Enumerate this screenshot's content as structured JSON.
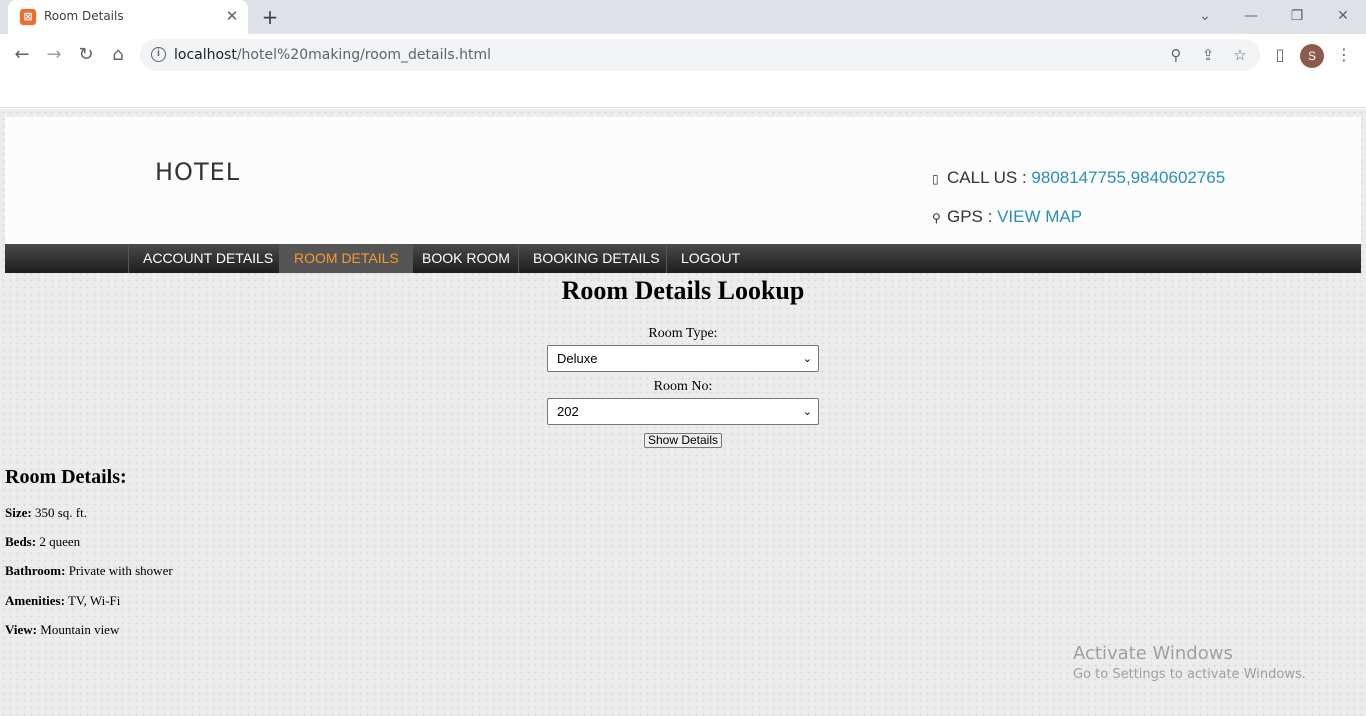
{
  "browser": {
    "tab_title": "Room Details",
    "tab_close": "✕",
    "new_tab": "+",
    "url_host": "localhost",
    "url_path": "/hotel%20making/room_details.html",
    "profile_initial": "S",
    "icons": [
      "hotel-favicon",
      "back-icon",
      "forward-icon",
      "reload-icon",
      "home-icon",
      "info-icon",
      "zoom-icon",
      "share-icon",
      "star-icon",
      "sidebar-icon",
      "menu-icon"
    ]
  },
  "header": {
    "logo": "HOTEL",
    "call_label": "CALL US : ",
    "call_value": "9808147755,9840602765",
    "gps_label": "GPS : ",
    "gps_value": "VIEW MAP",
    "accent_color": "#2a8fb8"
  },
  "nav": {
    "items": [
      "ACCOUNT DETAILS",
      "ROOM DETAILS",
      "BOOK ROOM",
      "BOOKING DETAILS",
      "LOGOUT"
    ],
    "active": "ROOM DETAILS",
    "active_color": "#f59a2f"
  },
  "lookup": {
    "title": "Room Details Lookup",
    "room_type_label": "Room Type:",
    "room_type_value": "Deluxe",
    "room_no_label": "Room No:",
    "room_no_value": "202",
    "button": "Show Details"
  },
  "details": {
    "heading": "Room Details:",
    "rows": [
      {
        "label": "Size:",
        "value": "350 sq. ft."
      },
      {
        "label": "Beds:",
        "value": "2 queen"
      },
      {
        "label": "Bathroom:",
        "value": "Private with shower"
      },
      {
        "label": "Amenities:",
        "value": "TV, Wi-Fi"
      },
      {
        "label": "View:",
        "value": "Mountain view"
      }
    ]
  },
  "watermark": {
    "line1": "Activate Windows",
    "line2": "Go to Settings to activate Windows."
  }
}
